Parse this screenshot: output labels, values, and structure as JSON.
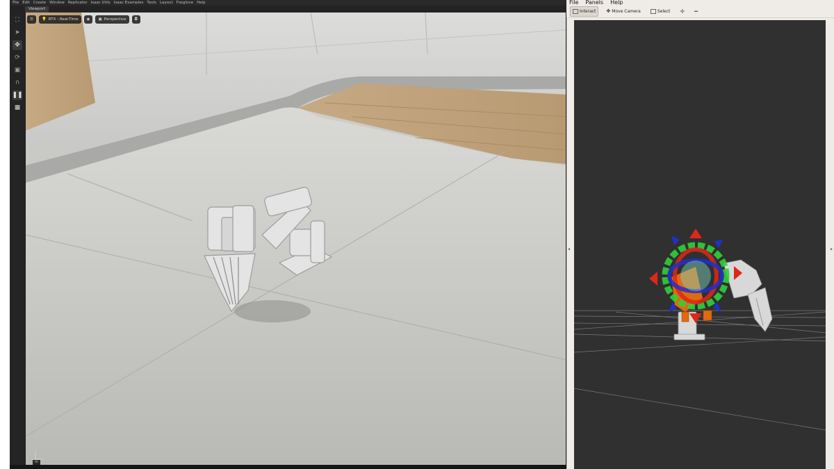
{
  "isaac_sim": {
    "menu": [
      "File",
      "Edit",
      "Create",
      "Window",
      "Replicator",
      "Isaac Utils",
      "Isaac Examples",
      "Tools",
      "Layout",
      "Foxglove",
      "Help"
    ],
    "tab": "Viewport",
    "viewport_toolbar": {
      "render_mode": "RTX - Real-Time",
      "camera": "Perspective"
    },
    "unit_badge": "m",
    "tools": [
      "select-frame-icon",
      "pointer-icon",
      "move-icon",
      "rotate-icon",
      "scale-icon",
      "snap-icon",
      "pause-icon",
      "stop-icon"
    ]
  },
  "rviz": {
    "menu": [
      "File",
      "Panels",
      "Help"
    ],
    "toolbar": {
      "interact": "Interact",
      "move_camera": "Move Camera",
      "select": "Select"
    }
  },
  "colors": {
    "editor_bg": "#1e1e1e",
    "rviz_bg": "#303030",
    "marker_green": "#2fd13a",
    "marker_red": "#e0261a",
    "marker_blue": "#2230c8",
    "marker_orange": "#e06a10"
  }
}
